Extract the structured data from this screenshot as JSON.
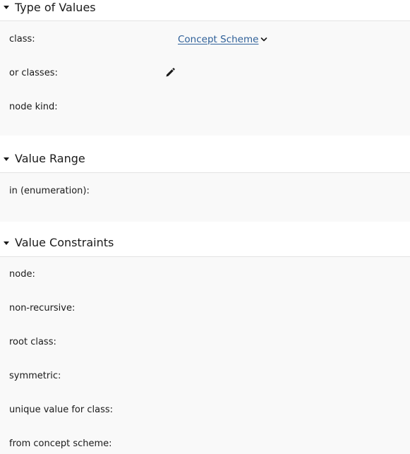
{
  "sections": [
    {
      "title": "Type of Values",
      "rows": [
        {
          "label": "class:",
          "value": "Concept Scheme"
        },
        {
          "label": "or classes:"
        },
        {
          "label": "node kind:"
        }
      ]
    },
    {
      "title": "Value Range",
      "rows": [
        {
          "label": "in (enumeration):"
        }
      ]
    },
    {
      "title": "Value Constraints",
      "rows": [
        {
          "label": "node:"
        },
        {
          "label": "non-recursive:"
        },
        {
          "label": "root class:"
        },
        {
          "label": "symmetric:"
        },
        {
          "label": "unique value for class:"
        },
        {
          "label": "from concept scheme:"
        }
      ]
    }
  ],
  "icons": {
    "expand": "caret-down-icon",
    "class_dropdown": "chevron-down-icon",
    "edit": "pencil-icon"
  },
  "colors": {
    "link": "#2d5f98",
    "text": "#1a1a1a",
    "panel_background": "#f9f9f9",
    "divider": "#e3e3e3"
  }
}
